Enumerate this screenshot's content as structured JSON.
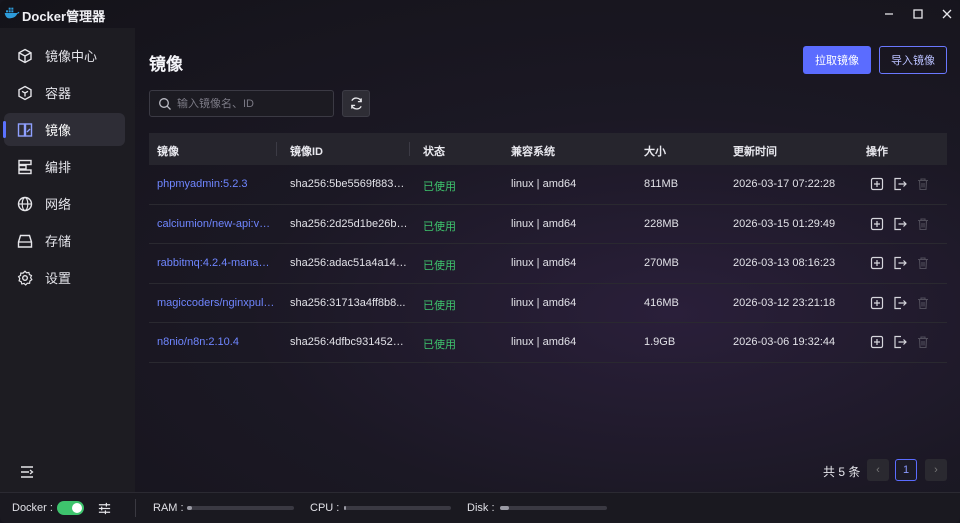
{
  "window": {
    "title": "Docker管理器"
  },
  "sidebar": {
    "items": [
      {
        "label": "镜像中心",
        "icon": "store-icon"
      },
      {
        "label": "容器",
        "icon": "box-icon"
      },
      {
        "label": "镜像",
        "icon": "image-icon",
        "active": true
      },
      {
        "label": "编排",
        "icon": "compose-icon"
      },
      {
        "label": "网络",
        "icon": "globe-icon"
      },
      {
        "label": "存储",
        "icon": "storage-icon"
      },
      {
        "label": "设置",
        "icon": "gear-icon"
      }
    ]
  },
  "main": {
    "title": "镜像",
    "pull_label": "拉取镜像",
    "import_label": "导入镜像",
    "search_placeholder": "输入镜像名、ID",
    "search_value": ""
  },
  "table": {
    "columns": [
      "镜像",
      "镜像ID",
      "状态",
      "兼容系统",
      "大小",
      "更新时间",
      "操作"
    ],
    "rows": [
      {
        "name": "phpmyadmin:5.2.3",
        "id": "sha256:5be5569f8836...",
        "status": "已使用",
        "os": "linux | amd64",
        "size": "811MB",
        "updated": "2026-03-17 07:22:28"
      },
      {
        "name": "calciumion/new-api:v0....",
        "id": "sha256:2d25d1be26ba...",
        "status": "已使用",
        "os": "linux | amd64",
        "size": "228MB",
        "updated": "2026-03-15 01:29:49"
      },
      {
        "name": "rabbitmq:4.2.4-manage...",
        "id": "sha256:adac51a4a14a...",
        "status": "已使用",
        "os": "linux | amd64",
        "size": "270MB",
        "updated": "2026-03-13 08:16:23"
      },
      {
        "name": "magiccoders/nginxpuls...",
        "id": "sha256:31713a4ff8b8...",
        "status": "已使用",
        "os": "linux | amd64",
        "size": "416MB",
        "updated": "2026-03-12 23:21:18"
      },
      {
        "name": "n8nio/n8n:2.10.4",
        "id": "sha256:4dfbc9314524...",
        "status": "已使用",
        "os": "linux | amd64",
        "size": "1.9GB",
        "updated": "2026-03-06 19:32:44"
      }
    ]
  },
  "pagination": {
    "total_label": "共 5 条",
    "current_page": "1",
    "prev": "‹",
    "next": "›"
  },
  "statusbar": {
    "docker_label": "Docker :",
    "docker_enabled": true,
    "ram_label": "RAM :",
    "cpu_label": "CPU :",
    "disk_label": "Disk :",
    "ram_level": 0.05,
    "cpu_level": 0.02,
    "disk_level": 0.08
  },
  "colors": {
    "accent": "#5b6cff",
    "link": "#6f86ff",
    "status_ok": "#3ec46d"
  }
}
